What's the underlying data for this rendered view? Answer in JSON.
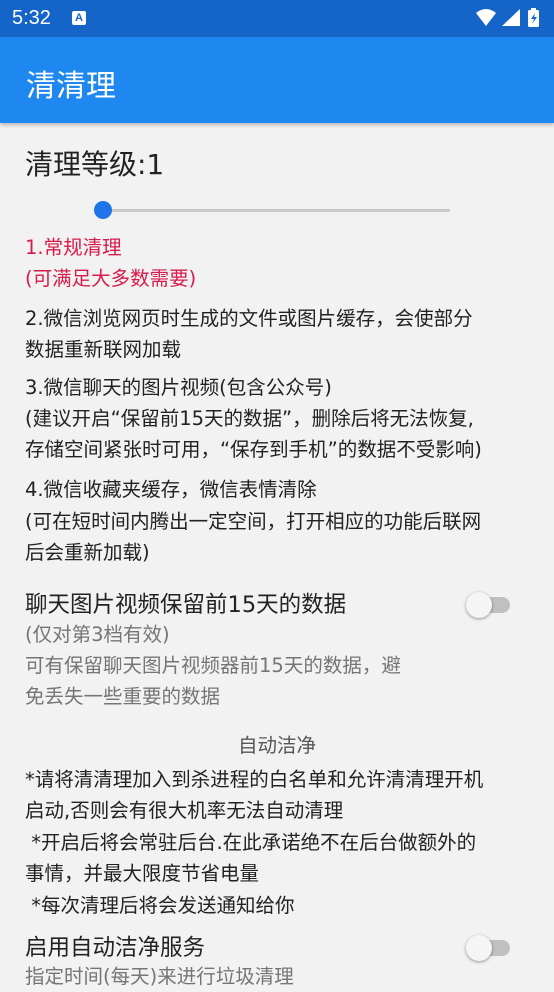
{
  "status_bar": {
    "time": "5:32",
    "notification_icon": "a-icon",
    "icons": [
      "wifi-icon",
      "signal-icon",
      "battery-icon"
    ]
  },
  "app_bar": {
    "title": "清清理"
  },
  "level": {
    "label": "清理等级:1",
    "slider_value": 1,
    "slider_min": 1,
    "slider_max": 4
  },
  "descriptions": {
    "item1_line1": "1.常规清理",
    "item1_line2": "(可满足大多数需要)",
    "item2_line1": "2.微信浏览网页时生成的文件或图片缓存，会使部分",
    "item2_line2": "数据重新联网加载",
    "item3_line1": "3.微信聊天的图片视频(包含公众号)",
    "item3_line2": "(建议开启“保留前15天的数据”，删除后将无法恢复,",
    "item3_line3": "存储空间紧张时可用，“保存到手机”的数据不受影响)",
    "item4_line1": "4.微信收藏夹缓存，微信表情清除",
    "item4_line2": "(可在短时间内腾出一定空间，打开相应的功能后联网",
    "item4_line3": "后会重新加载)"
  },
  "keep15": {
    "title": "聊天图片视频保留前15天的数据",
    "sub1": "(仅对第3档有效)",
    "sub2": "可有保留聊天图片视频器前15天的数据，避",
    "sub3": "免丢失一些重要的数据",
    "enabled": false
  },
  "auto_clean": {
    "header": "自动洁净",
    "note1_line1": "*请将清清理加入到杀进程的白名单和允许清清理开机",
    "note1_line2": "启动,否则会有很大机率无法自动清理",
    "note2_line1": " *开启后将会常驻后台.在此承诺绝不在后台做额外的",
    "note2_line2": "事情，并最大限度节省电量",
    "note3": " *每次清理后将会发送通知给你",
    "service_title": "启用自动洁净服务",
    "service_sub": "指定时间(每天)来进行垃圾清理",
    "enabled": false
  },
  "colors": {
    "status_bar": "#1565c8",
    "app_bar": "#1e88f0",
    "accent": "#1e74e8",
    "highlight_text": "#d81b4a"
  }
}
